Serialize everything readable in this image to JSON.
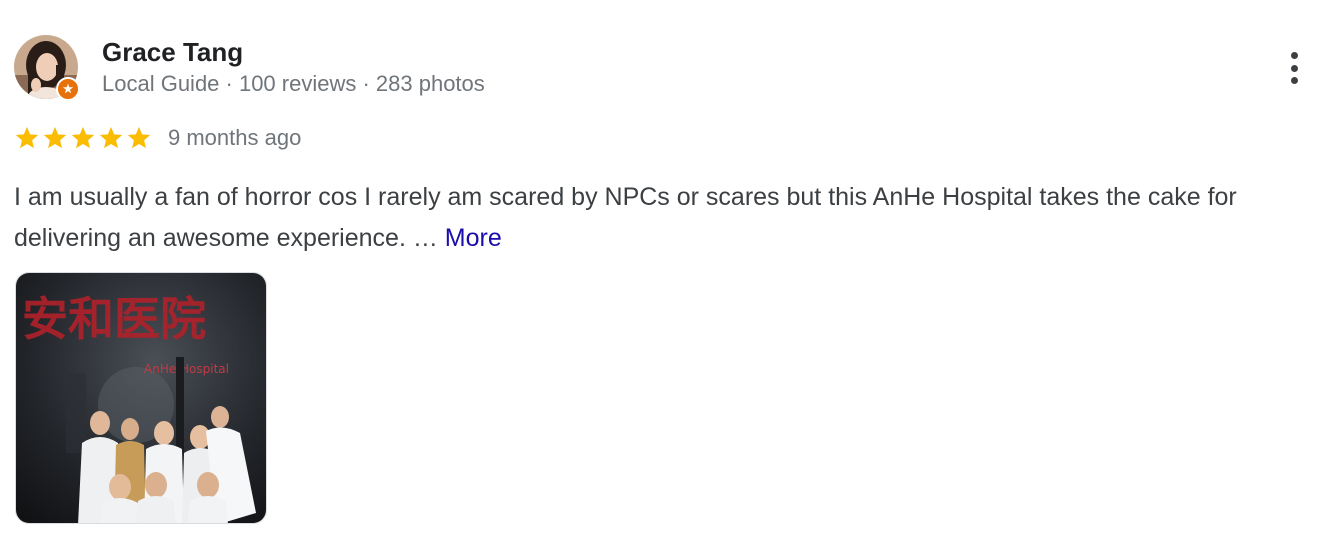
{
  "review": {
    "author": {
      "name": "Grace Tang",
      "meta": "Local Guide · 100 reviews · 283 photos",
      "avatar_icon": "profile-photo",
      "badge_icon": "local-guide-badge-icon",
      "badge_color": "#e8710a"
    },
    "rating": {
      "stars": 5,
      "max_stars": 5,
      "star_color": "#fbbc04"
    },
    "time_ago": "9 months ago",
    "text": "I am usually a fan of horror cos I rarely am scared by NPCs or scares but this AnHe Hospital takes the cake for delivering an awesome experience. …",
    "more_label": "More",
    "more_color": "#1a0dab",
    "menu_icon": "more-vert-icon",
    "photo": {
      "sign_text": "安和医院",
      "sign_subtext": "AnHe Hospital",
      "sign_color": "#b0212a"
    }
  }
}
